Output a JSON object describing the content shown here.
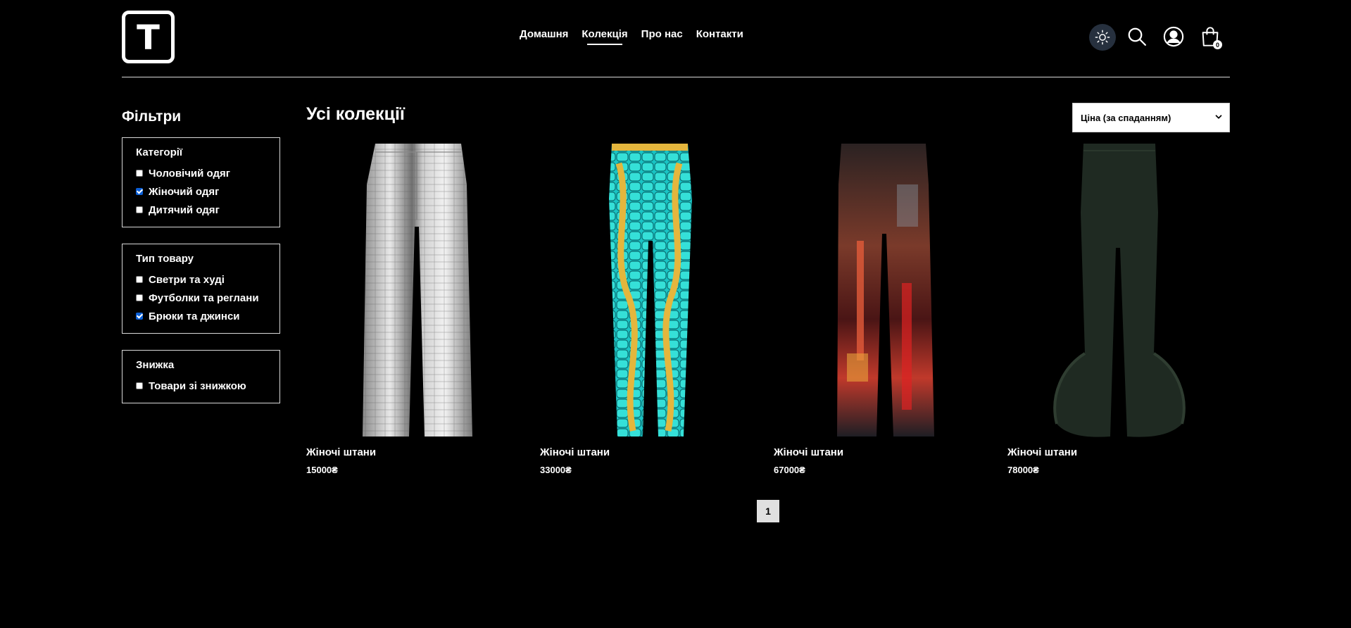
{
  "logo": {
    "letter": "T"
  },
  "nav": {
    "items": [
      {
        "label": "Домашня",
        "active": false
      },
      {
        "label": "Колекція",
        "active": true
      },
      {
        "label": "Про нас",
        "active": false
      },
      {
        "label": "Контакти",
        "active": false
      }
    ]
  },
  "header": {
    "icons": [
      "sun-icon",
      "search-icon",
      "user-icon",
      "shopping-bag-icon"
    ],
    "cart_count": "0"
  },
  "sidebar": {
    "title": "Фільтри",
    "groups": [
      {
        "title": "Категорії",
        "options": [
          {
            "label": "Чоловічий одяг",
            "checked": false
          },
          {
            "label": "Жіночий одяг",
            "checked": true
          },
          {
            "label": "Дитячий одяг",
            "checked": false
          }
        ]
      },
      {
        "title": "Тип товару",
        "options": [
          {
            "label": "Светри та худі",
            "checked": false
          },
          {
            "label": "Футболки та реглани",
            "checked": false
          },
          {
            "label": "Брюки та джинси",
            "checked": true
          }
        ]
      },
      {
        "title": "Знижка",
        "options": [
          {
            "label": "Товари зі знижкою",
            "checked": false
          }
        ]
      }
    ]
  },
  "main": {
    "title": "Усі колекції",
    "sort": {
      "selected": "Ціна (за спаданням)"
    },
    "products": [
      {
        "name": "Жіночі штани",
        "price": "15000₴",
        "image": "silver-croc-trousers"
      },
      {
        "name": "Жіночі штани",
        "price": "33000₴",
        "image": "turquoise-baroque-leggings"
      },
      {
        "name": "Жіночі штани",
        "price": "67000₴",
        "image": "neon-print-flared-trousers"
      },
      {
        "name": "Жіночі штани",
        "price": "78000₴",
        "image": "dark-green-ruffle-flares"
      }
    ]
  },
  "pagination": {
    "current": "1"
  },
  "colors": {
    "background": "#000000",
    "theme_button": "#26303e",
    "checkbox_checked": "#0b5fd6"
  }
}
